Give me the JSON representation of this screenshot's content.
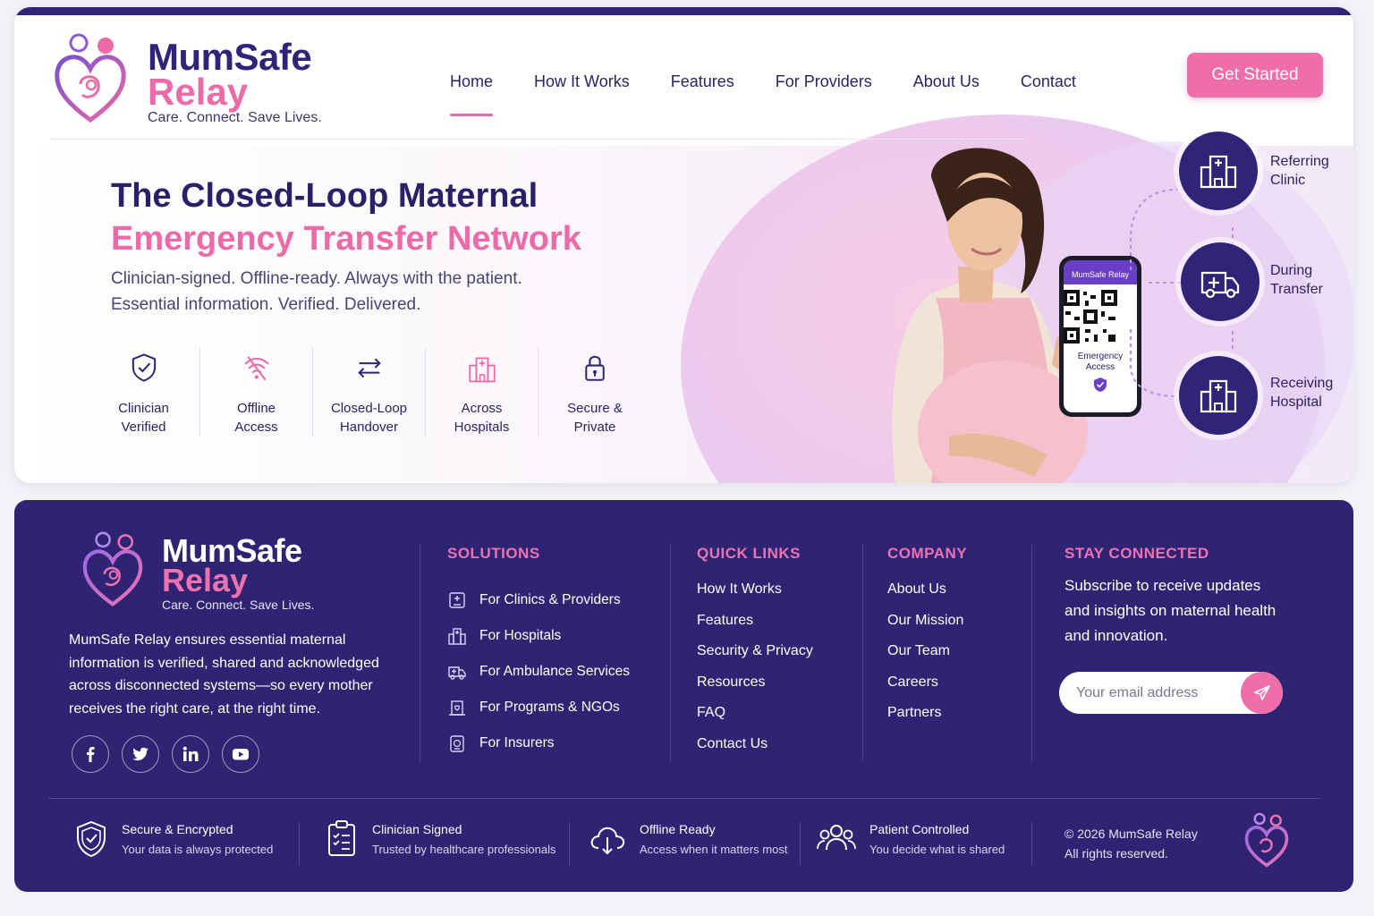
{
  "brand": {
    "name1": "MumSafe",
    "name2": "Relay",
    "tagline": "Care. Connect. Save Lives."
  },
  "nav": {
    "items": [
      {
        "label": "Home",
        "active": true
      },
      {
        "label": "How It Works"
      },
      {
        "label": "Features"
      },
      {
        "label": "For Providers"
      },
      {
        "label": "About Us"
      },
      {
        "label": "Contact"
      }
    ],
    "cta_label": "Get Started"
  },
  "hero": {
    "title_line1": "The Closed-Loop Maternal",
    "title_line2": "Emergency Transfer Network",
    "subtitle_line1": "Clinician-signed. Offline-ready. Always with the patient.",
    "subtitle_line2": "Essential information. Verified. Delivered.",
    "features": [
      {
        "label": "Clinician\nVerified",
        "icon": "shield-check-icon"
      },
      {
        "label": "Offline\nAccess",
        "icon": "wifi-off-icon"
      },
      {
        "label": "Closed-Loop\nHandover",
        "icon": "swap-arrows-icon"
      },
      {
        "label": "Across\nHospitals",
        "icon": "hospital-icon"
      },
      {
        "label": "Secure &\nPrivate",
        "icon": "lock-icon"
      }
    ],
    "phone": {
      "app_name": "MumSafe Relay",
      "access_label": "Emergency\nAccess"
    },
    "steps": [
      {
        "label": "Referring\nClinic",
        "icon": "clinic-building-icon"
      },
      {
        "label": "During\nTransfer",
        "icon": "ambulance-icon"
      },
      {
        "label": "Receiving\nHospital",
        "icon": "hospital-building-icon"
      }
    ]
  },
  "footer": {
    "description": "MumSafe Relay ensures essential maternal information is verified, shared and acknowledged across disconnected systems—so every mother receives the right care, at the right time.",
    "socials": [
      "facebook-icon",
      "twitter-icon",
      "linkedin-icon",
      "youtube-icon"
    ],
    "solutions": {
      "heading": "SOLUTIONS",
      "items": [
        "For Clinics & Providers",
        "For Hospitals",
        "For Ambulance Services",
        "For Programs & NGOs",
        "For Insurers"
      ]
    },
    "quick_links": {
      "heading": "QUICK LINKS",
      "items": [
        "How It Works",
        "Features",
        "Security & Privacy",
        "Resources",
        "FAQ",
        "Contact Us"
      ]
    },
    "company": {
      "heading": "COMPANY",
      "items": [
        "About Us",
        "Our Mission",
        "Our Team",
        "Careers",
        "Partners"
      ]
    },
    "stay_connected": {
      "heading": "STAY CONNECTED",
      "text": "Subscribe to receive updates and insights on maternal health and innovation.",
      "email_placeholder": "Your email address"
    },
    "trust": [
      {
        "title": "Secure & Encrypted",
        "desc": "Your data is always protected"
      },
      {
        "title": "Clinician Signed",
        "desc": "Trusted by healthcare professionals"
      },
      {
        "title": "Offline Ready",
        "desc": "Access when it matters most"
      },
      {
        "title": "Patient Controlled",
        "desc": "You decide what is shared"
      }
    ],
    "copyright": "© 2026 MumSafe Relay\nAll rights reserved."
  },
  "colors": {
    "primary": "#2f2478",
    "accent": "#ec6aa8"
  }
}
